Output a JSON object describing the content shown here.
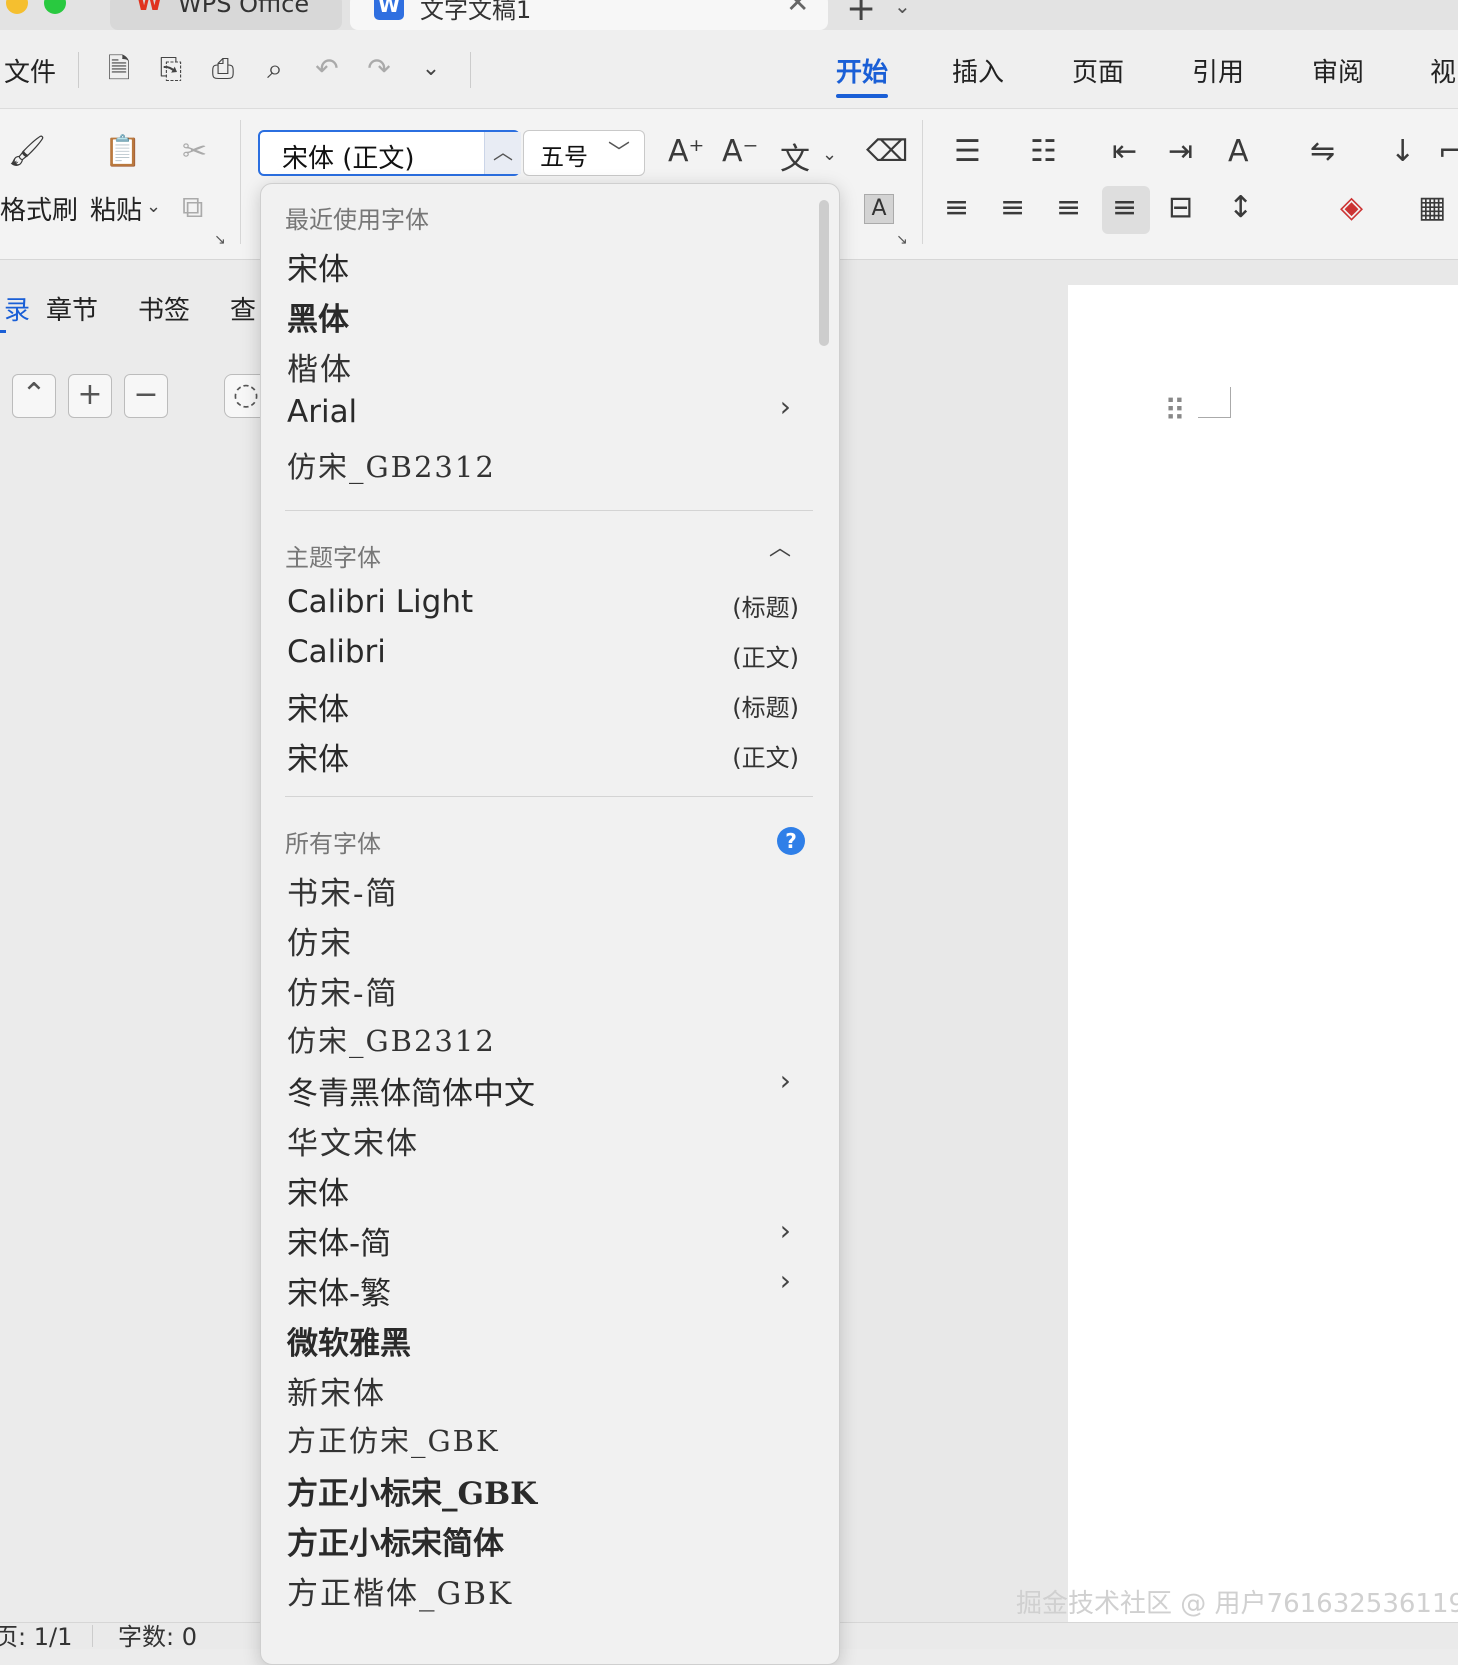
{
  "titlebar": {
    "tabs": [
      {
        "label": "WPS Office"
      },
      {
        "label": "文字文稿1"
      }
    ],
    "new_tab": "+"
  },
  "menu": {
    "file": "文件",
    "nav_tabs": [
      "开始",
      "插入",
      "页面",
      "引用",
      "审阅",
      "视"
    ]
  },
  "ribbon": {
    "format_painter": "格式刷",
    "paste": "粘贴",
    "font_value": "宋体 (正文)",
    "size_value": "五号",
    "char_shading": "A"
  },
  "leftpane": {
    "tabs": [
      "目录",
      "章节",
      "书签",
      "查"
    ]
  },
  "dropdown": {
    "recent_header": "最近使用字体",
    "recent": [
      {
        "name": "宋体"
      },
      {
        "name": "黑体"
      },
      {
        "name": "楷体"
      },
      {
        "name": "Arial",
        "submenu": true
      },
      {
        "name": "仿宋_GB2312"
      }
    ],
    "theme_header": "主题字体",
    "theme": [
      {
        "name": "Calibri Light",
        "tag": "(标题)"
      },
      {
        "name": "Calibri",
        "tag": "(正文)"
      },
      {
        "name": "宋体",
        "tag": "(标题)"
      },
      {
        "name": "宋体",
        "tag": "(正文)"
      }
    ],
    "all_header": "所有字体",
    "help": "?",
    "all": [
      {
        "name": "书宋-简"
      },
      {
        "name": "仿宋"
      },
      {
        "name": "仿宋-简"
      },
      {
        "name": "仿宋_GB2312"
      },
      {
        "name": "冬青黑体简体中文",
        "submenu": true
      },
      {
        "name": "华文宋体"
      },
      {
        "name": "宋体"
      },
      {
        "name": "宋体-简",
        "submenu": true
      },
      {
        "name": "宋体-繁",
        "submenu": true
      },
      {
        "name": "微软雅黑"
      },
      {
        "name": "新宋体"
      },
      {
        "name": "方正仿宋_GBK"
      },
      {
        "name": "方正小标宋_GBK"
      },
      {
        "name": "方正小标宋简体"
      },
      {
        "name": "方正楷体_GBK"
      }
    ]
  },
  "status": {
    "page": "页: 1/1",
    "words": "字数: 0"
  },
  "watermark": "掘金技术社区 @ 用户761632536119",
  "colors": {
    "accent": "#1a5fd6",
    "help": "#2f7fe8"
  }
}
